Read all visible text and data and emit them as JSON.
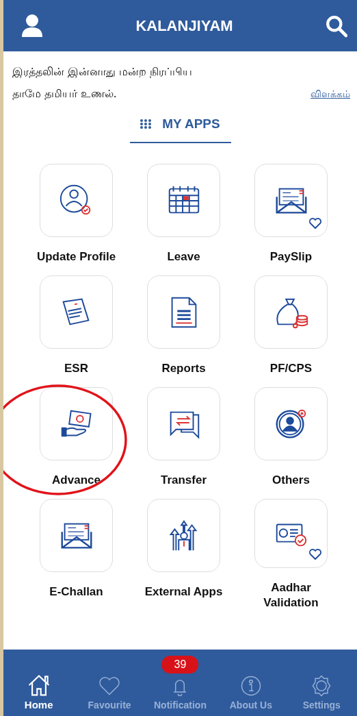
{
  "header": {
    "title": "KALANJIYAM"
  },
  "quote": {
    "text": "இரத்தலின் இன்னாது மன்ற நிரப்பிய தாமே தமியர் உணல்.",
    "link": "விளக்கம்"
  },
  "section": {
    "title": "MY APPS"
  },
  "apps": [
    {
      "label": "Update Profile",
      "favourite": false
    },
    {
      "label": "Leave",
      "favourite": false
    },
    {
      "label": "PaySlip",
      "favourite": true
    },
    {
      "label": "ESR",
      "favourite": false
    },
    {
      "label": "Reports",
      "favourite": false
    },
    {
      "label": "PF/CPS",
      "favourite": false
    },
    {
      "label": "Advance",
      "favourite": false,
      "circled": true
    },
    {
      "label": "Transfer",
      "favourite": false
    },
    {
      "label": "Others",
      "favourite": false
    },
    {
      "label": "E-Challan",
      "favourite": false
    },
    {
      "label": "External Apps",
      "favourite": false
    },
    {
      "label": "Aadhar Validation",
      "favourite": true
    }
  ],
  "nav": [
    {
      "label": "Home",
      "selected": true
    },
    {
      "label": "Favourite",
      "selected": false
    },
    {
      "label": "Notification",
      "selected": false,
      "badge": "39"
    },
    {
      "label": "About Us",
      "selected": false
    },
    {
      "label": "Settings",
      "selected": false
    }
  ]
}
